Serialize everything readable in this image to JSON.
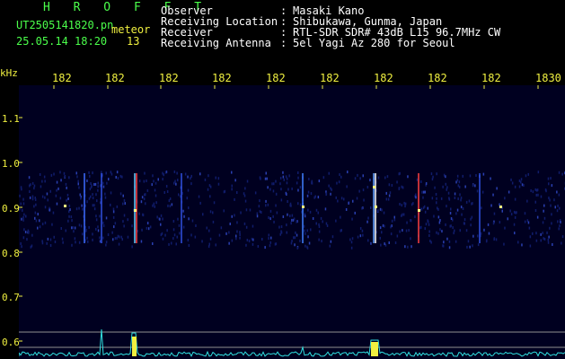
{
  "header": {
    "title": "H R O F F T",
    "file_name": "UT2505141820.pn",
    "date_time": "25.05.14 18:20",
    "page_count": "13",
    "detection_label": "meteor"
  },
  "info": {
    "rows": [
      {
        "label": "Observer",
        "sep": ":",
        "value": "Masaki Kano"
      },
      {
        "label": "Receiving Location",
        "sep": ":",
        "value": "Shibukawa, Gunma, Japan"
      },
      {
        "label": "Receiver",
        "sep": ":",
        "value": "RTL-SDR SDR# 43dB L15 96.7MHz CW"
      },
      {
        "label": "Receiving Antenna",
        "sep": ":",
        "value": "5el Yagi Az 280 for Seoul"
      }
    ]
  },
  "axis": {
    "y_unit": "kHz",
    "y_ticks": [
      "1.1",
      "1.0",
      "0.9",
      "0.8",
      "0.7",
      "0.6"
    ],
    "x_ticks": [
      "182",
      "182",
      "182",
      "182",
      "182",
      "182",
      "182",
      "182",
      "182",
      "1830"
    ]
  },
  "colors": {
    "green": "#4bff4b",
    "yellow": "#f0f040",
    "white": "#ffffff",
    "cyan": "#30e0e0",
    "plot_bg": "#000020"
  }
}
